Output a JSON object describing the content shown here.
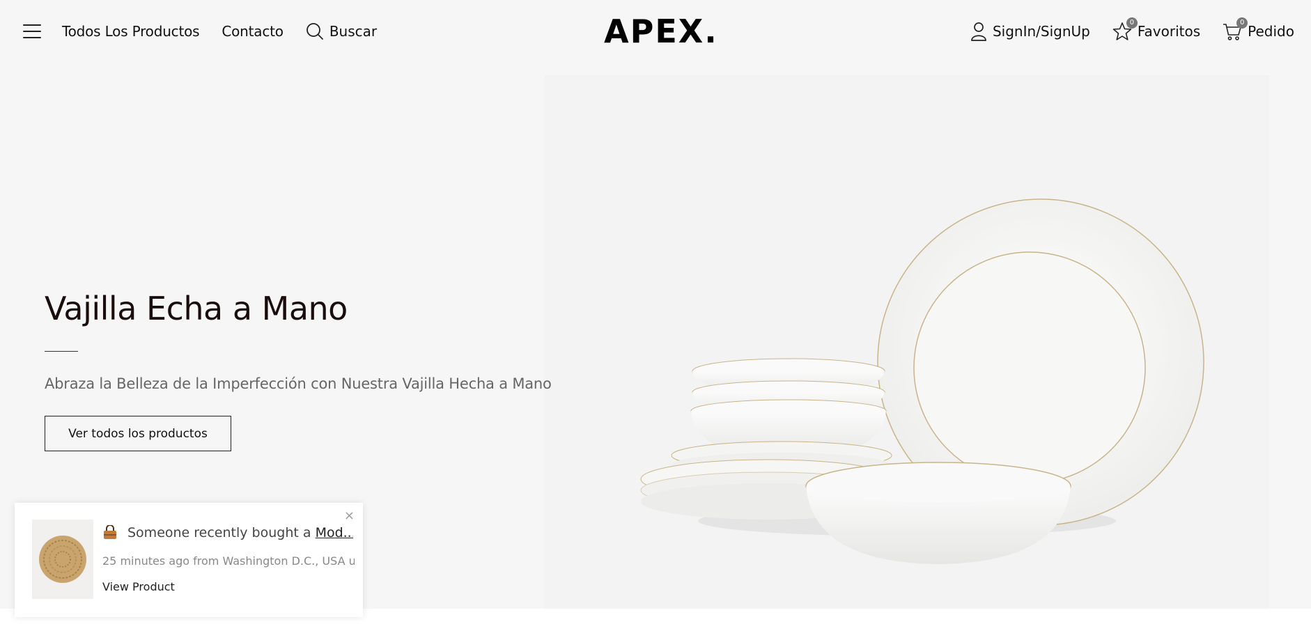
{
  "header": {
    "nav_left": [
      "Todos Los Productos",
      "Contacto"
    ],
    "search_label": "Buscar",
    "logo": "APEX.",
    "signin_label": "SignIn/SignUp",
    "favorites_label": "Favoritos",
    "favorites_count": "0",
    "order_label": "Pedido",
    "order_count": "0"
  },
  "hero": {
    "title": "Vajilla Echa a Mano",
    "subtitle": "Abraza la Belleza de la Imperfección con Nuestra Vajilla Hecha a Mano",
    "button_label": "Ver todos los productos"
  },
  "toast": {
    "message_prefix": "Someone recently bought a ",
    "product_link": "Mod...",
    "time_location": "25 minutes ago from Washington D.C., USA u",
    "view_label": "View Product",
    "close_glyph": "×"
  }
}
